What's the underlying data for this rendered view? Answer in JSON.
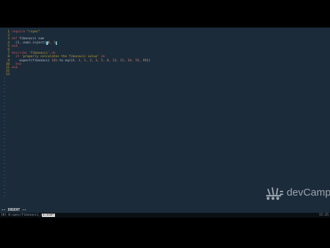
{
  "editor": {
    "lines": [
      {
        "n": "1",
        "parts": [
          {
            "t": "require ",
            "c": "kw"
          },
          {
            "t": "\"rspec\"",
            "c": "str"
          }
        ]
      },
      {
        "n": "2",
        "parts": []
      },
      {
        "n": "3",
        "parts": [
          {
            "t": "def ",
            "c": "kw"
          },
          {
            "t": "fibonacci num",
            "c": "id"
          }
        ]
      },
      {
        "n": "4",
        "parts": [
          {
            "t": "  (1..num).inject(",
            "c": "id"
          },
          {
            "t": "[",
            "c": "cursor"
          },
          {
            "t": "0, 1",
            "c": "num"
          },
          {
            "t": "]",
            "c": "cursor"
          }
        ]
      },
      {
        "n": "5",
        "parts": [
          {
            "t": "end",
            "c": "kw"
          }
        ]
      },
      {
        "n": "6",
        "parts": []
      },
      {
        "n": "7",
        "parts": [
          {
            "t": "describe ",
            "c": "kw"
          },
          {
            "t": "'fibonacci'",
            "c": "str"
          },
          {
            "t": " do",
            "c": "kw"
          }
        ]
      },
      {
        "n": "8",
        "parts": [
          {
            "t": "  it ",
            "c": "kw"
          },
          {
            "t": "'properly calculates the fibonacci value'",
            "c": "str"
          },
          {
            "t": " do",
            "c": "kw"
          }
        ]
      },
      {
        "n": "9",
        "parts": [
          {
            "t": "    expect(fibonacci ",
            "c": "id"
          },
          {
            "t": "10",
            "c": "num"
          },
          {
            "t": ").to eq([",
            "c": "id"
          },
          {
            "t": "0, 1, 1, 2, 3, 5, 8, 13, 21, 34, 55, 89",
            "c": "num"
          },
          {
            "t": "])",
            "c": "id"
          }
        ]
      },
      {
        "n": "10",
        "parts": [
          {
            "t": "  end",
            "c": "kw"
          }
        ]
      },
      {
        "n": "11",
        "parts": [
          {
            "t": "end",
            "c": "kw"
          }
        ]
      },
      {
        "n": "12",
        "parts": []
      },
      {
        "n": "13",
        "parts": []
      }
    ],
    "tilde_count": 34,
    "tilde_char": "~"
  },
  "status": {
    "mode": "-- INSERT --"
  },
  "tmux": {
    "session_label": "[0] 0:spec/fibonacci_spec.rb",
    "active_window": "1:vim*",
    "clock": "15:25"
  },
  "watermark": {
    "brand": "devCamp",
    "logo_icon": "devcamp-logo-icon"
  },
  "colors": {
    "editor_bg": "#1b2b3a",
    "line_number": "#c9a227",
    "keyword": "#c05a5a",
    "string": "#c9a227",
    "tilde": "#3f6fb0",
    "cursor": "#7fd8e0"
  }
}
